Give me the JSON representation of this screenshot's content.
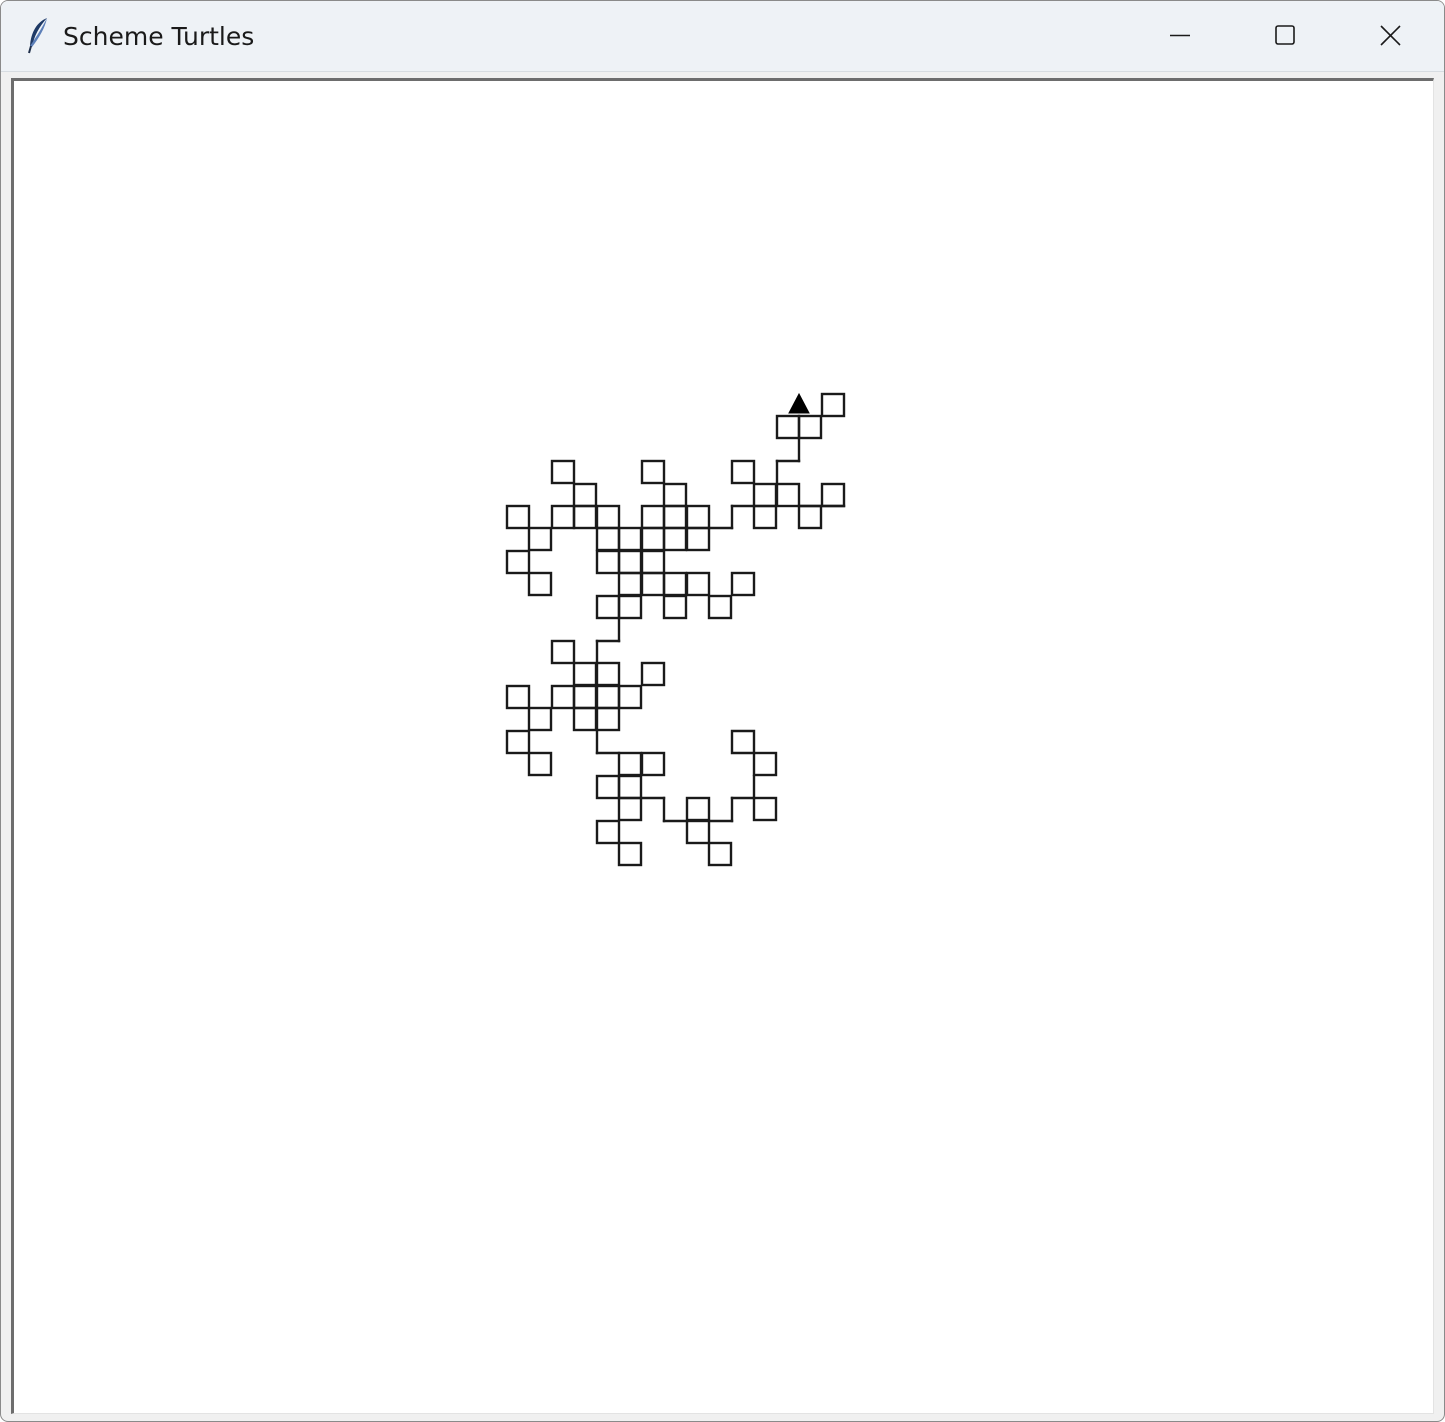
{
  "window": {
    "title": "Scheme Turtles",
    "controls": {
      "minimize": "minimize-icon",
      "maximize": "maximize-icon",
      "close": "close-icon"
    }
  },
  "canvas": {
    "background": "#ffffff",
    "pen_color": "#1a1a1a",
    "turtle": {
      "shape": "triangle",
      "heading": "up",
      "color": "#000000"
    }
  },
  "icons": {
    "app": "feather-icon"
  }
}
